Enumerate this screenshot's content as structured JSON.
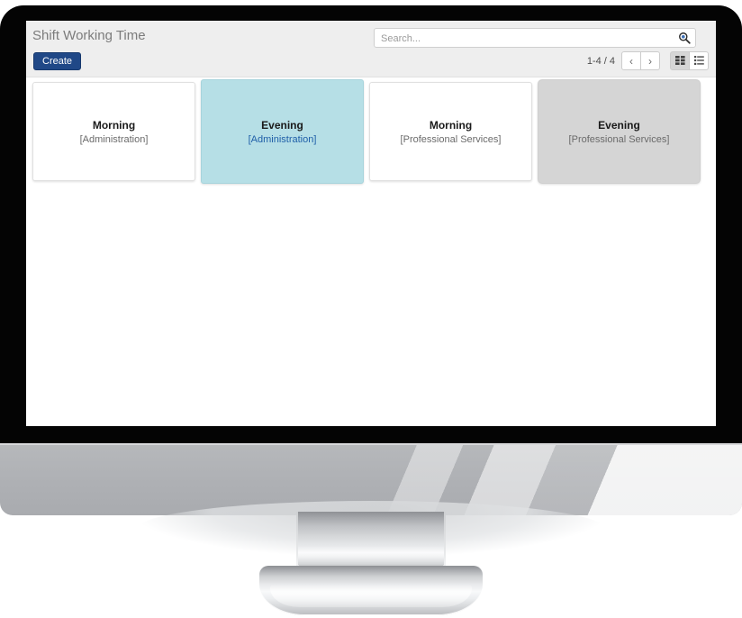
{
  "device": {
    "type": "desktop-monitor"
  },
  "app": {
    "breadcrumb": "Shift Working Time",
    "create_label": "Create",
    "search": {
      "placeholder": "Search...",
      "value": "",
      "icon": "search-icon"
    },
    "pager": {
      "count_label": "1-4 / 4",
      "prev_glyph": "‹",
      "next_glyph": "›"
    },
    "view_switch": {
      "kanban": {
        "icon": "kanban-grid-icon",
        "active": true
      },
      "list": {
        "icon": "list-icon",
        "active": false
      }
    },
    "accent_color": "#204887",
    "selected_card_color": "#b6dfe6",
    "hovered_card_color": "#d5d5d5",
    "link_color": "#1f5fa8"
  },
  "kanban": {
    "cards": [
      {
        "title": "Morning",
        "subtitle": "[Administration]",
        "state": "normal"
      },
      {
        "title": "Evening",
        "subtitle": "[Administration]",
        "state": "selected"
      },
      {
        "title": "Morning",
        "subtitle": "[Professional Services]",
        "state": "normal"
      },
      {
        "title": "Evening",
        "subtitle": "[Professional Services]",
        "state": "hovered"
      }
    ]
  }
}
